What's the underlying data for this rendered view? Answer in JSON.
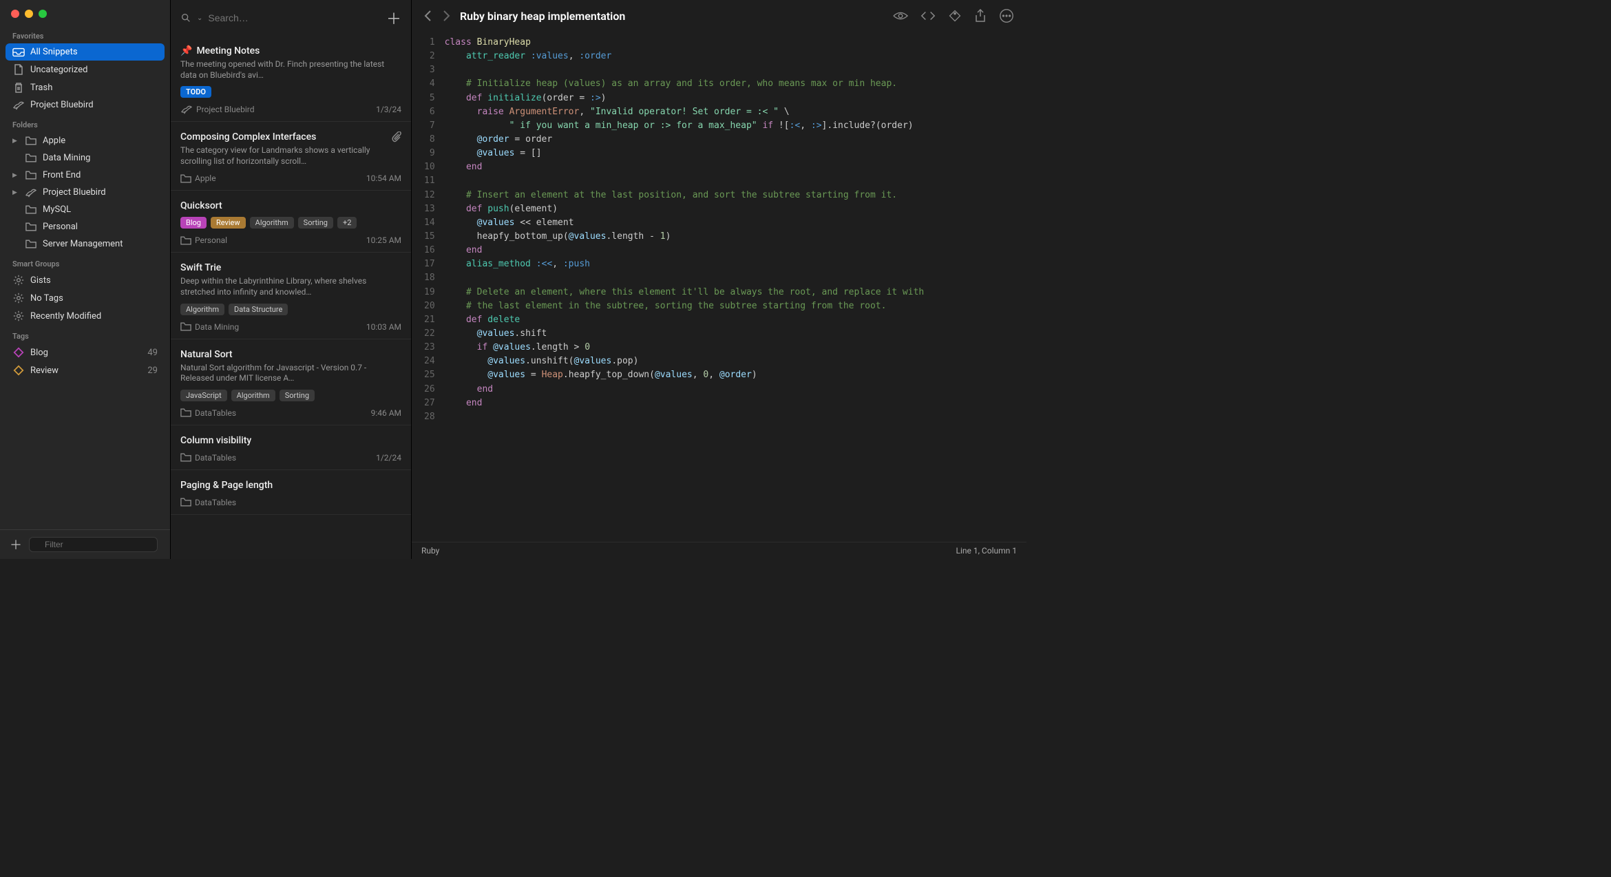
{
  "search_placeholder": "Search…",
  "filter_placeholder": "Filter",
  "sidebar": {
    "sections": [
      {
        "title": "Favorites",
        "items": [
          {
            "icon": "tray",
            "label": "All Snippets",
            "selected": true
          },
          {
            "icon": "doc",
            "label": "Uncategorized"
          },
          {
            "icon": "trash",
            "label": "Trash"
          },
          {
            "icon": "bird",
            "label": "Project Bluebird"
          }
        ]
      },
      {
        "title": "Folders",
        "items": [
          {
            "icon": "folder",
            "label": "Apple",
            "chev": true
          },
          {
            "icon": "folder",
            "label": "Data Mining"
          },
          {
            "icon": "folder",
            "label": "Front End",
            "chev": true
          },
          {
            "icon": "bird",
            "label": "Project Bluebird",
            "chev": true
          },
          {
            "icon": "folder",
            "label": "MySQL"
          },
          {
            "icon": "folder",
            "label": "Personal"
          },
          {
            "icon": "folder",
            "label": "Server Management"
          }
        ]
      },
      {
        "title": "Smart Groups",
        "items": [
          {
            "icon": "gear",
            "label": "Gists"
          },
          {
            "icon": "gear",
            "label": "No Tags"
          },
          {
            "icon": "gear",
            "label": "Recently Modified"
          }
        ]
      },
      {
        "title": "Tags",
        "items": [
          {
            "icon": "tag",
            "label": "Blog",
            "count": "49",
            "color": "#b843b8"
          },
          {
            "icon": "tag",
            "label": "Review",
            "count": "29",
            "color": "#d09a3a"
          }
        ]
      }
    ]
  },
  "snippets": [
    {
      "pinned": true,
      "title": "Meeting Notes",
      "excerpt": "The meeting opened with Dr. Finch presenting the latest data on Bluebird's avi…",
      "tags": [
        {
          "label": "TODO",
          "kind": "todo"
        }
      ],
      "location_icon": "bird",
      "location": "Project Bluebird",
      "date": "1/3/24"
    },
    {
      "title": "Composing Complex Interfaces",
      "attachment": true,
      "excerpt": "The category view for Landmarks shows a vertically scrolling list of horizontally scroll…",
      "tags": [],
      "location_icon": "folder",
      "location": "Apple",
      "date": "10:54 AM"
    },
    {
      "title": "Quicksort",
      "excerpt": "",
      "tags": [
        {
          "label": "Blog",
          "kind": "blog"
        },
        {
          "label": "Review",
          "kind": "review"
        },
        {
          "label": "Algorithm",
          "kind": ""
        },
        {
          "label": "Sorting",
          "kind": ""
        },
        {
          "label": "+2",
          "kind": ""
        }
      ],
      "location_icon": "folder",
      "location": "Personal",
      "date": "10:25 AM"
    },
    {
      "title": "Swift Trie",
      "excerpt": "Deep within the Labyrinthine Library, where shelves stretched into infinity and knowled…",
      "tags": [
        {
          "label": "Algorithm",
          "kind": ""
        },
        {
          "label": "Data Structure",
          "kind": ""
        }
      ],
      "location_icon": "folder",
      "location": "Data Mining",
      "date": "10:03 AM"
    },
    {
      "title": "Natural Sort",
      "excerpt": "Natural Sort algorithm for Javascript - Version 0.7 - Released under MIT license A…",
      "tags": [
        {
          "label": "JavaScript",
          "kind": ""
        },
        {
          "label": "Algorithm",
          "kind": ""
        },
        {
          "label": "Sorting",
          "kind": ""
        }
      ],
      "location_icon": "folder",
      "location": "DataTables",
      "date": "9:46 AM"
    },
    {
      "title": "Column visibility",
      "excerpt": "",
      "tags": [],
      "location_icon": "folder",
      "location": "DataTables",
      "date": "1/2/24"
    },
    {
      "title": "Paging & Page length",
      "excerpt": "",
      "tags": [],
      "location_icon": "folder",
      "location": "DataTables",
      "date": ""
    }
  ],
  "editor": {
    "title": "Ruby binary heap implementation",
    "language": "Ruby",
    "cursor": "Line 1, Column 1",
    "lines": [
      "<span class='kw'>class</span> <span class='cls'>BinaryHeap</span>",
      "    <span class='fn'>attr_reader</span> <span class='sym'>:values</span>, <span class='sym'>:order</span>",
      "",
      "    <span class='cmt'># Initialize heap (values) as an array and its order, who means max or min heap.</span>",
      "    <span class='kw'>def</span> <span class='fn'>initialize</span>(order = <span class='sym'>:&gt;</span>)",
      "      <span class='kw'>raise</span> <span class='err'>ArgumentError</span>, <span class='str'>\"Invalid operator! Set order = :&lt; \"</span> \\",
      "            <span class='str'>\" if you want a min_heap or :&gt; for a max_heap\"</span> <span class='kw'>if</span> ![<span class='sym'>:&lt;</span>, <span class='sym'>:&gt;</span>].include?(order)",
      "      <span class='var'>@order</span> = order",
      "      <span class='var'>@values</span> = []",
      "    <span class='kw'>end</span>",
      "",
      "    <span class='cmt'># Insert an element at the last position, and sort the subtree starting from it.</span>",
      "    <span class='kw'>def</span> <span class='fn'>push</span>(element)",
      "      <span class='var'>@values</span> &lt;&lt; element",
      "      heapfy_bottom_up(<span class='var'>@values</span>.length - <span class='num'>1</span>)",
      "    <span class='kw'>end</span>",
      "    <span class='fn'>alias_method</span> <span class='sym'>:&lt;&lt;</span>, <span class='sym'>:push</span>",
      "",
      "    <span class='cmt'># Delete an element, where this element it'll be always the root, and replace it with</span>",
      "    <span class='cmt'># the last element in the subtree, sorting the subtree starting from the root.</span>",
      "    <span class='kw'>def</span> <span class='fn'>delete</span>",
      "      <span class='var'>@values</span>.shift",
      "      <span class='kw'>if</span> <span class='var'>@values</span>.length &gt; <span class='num'>0</span>",
      "        <span class='var'>@values</span>.unshift(<span class='var'>@values</span>.pop)",
      "        <span class='var'>@values</span> = <span class='err'>Heap</span>.heapfy_top_down(<span class='var'>@values</span>, <span class='num'>0</span>, <span class='var'>@order</span>)",
      "      <span class='kw'>end</span>",
      "    <span class='kw'>end</span>",
      ""
    ]
  }
}
